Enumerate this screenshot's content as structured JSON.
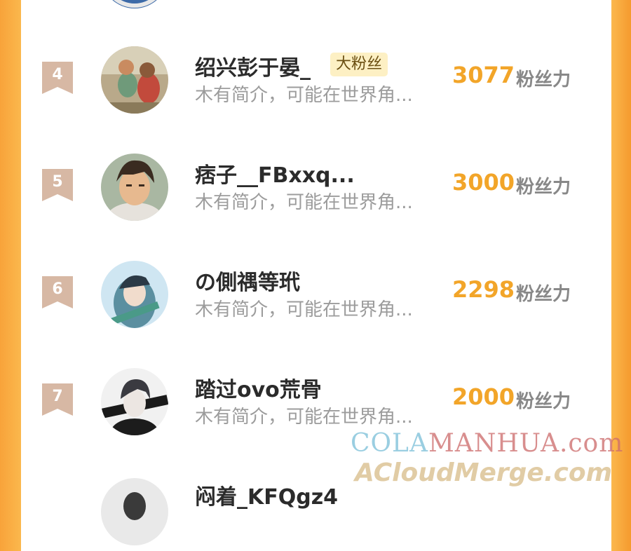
{
  "colors": {
    "accent": "#f2a529",
    "rank_badge": "#d7b8a4",
    "name": "#2b2b2b",
    "bio": "#9c9c9c",
    "badge_bg": "#fdf0c4"
  },
  "score_unit": "粉丝力",
  "rows": [
    {
      "rank": "4",
      "name": "绍兴彭于晏_",
      "badge": "大粉丝",
      "bio": "木有简介，可能在世界角...",
      "score": "3077",
      "avatar_icon": "avatar-icon"
    },
    {
      "rank": "5",
      "name": "痞子__FBxxq...",
      "badge": "",
      "bio": "木有简介，可能在世界角...",
      "score": "3000",
      "avatar_icon": "avatar-icon"
    },
    {
      "rank": "6",
      "name": "の側禑等玳",
      "badge": "",
      "bio": "木有简介，可能在世界角...",
      "score": "2298",
      "avatar_icon": "avatar-icon"
    },
    {
      "rank": "7",
      "name": "踏过ovo荒骨",
      "badge": "",
      "bio": "木有简介，可能在世界角...",
      "score": "2000",
      "avatar_icon": "avatar-icon"
    },
    {
      "rank": "",
      "name": "闷着_KFQgz4",
      "badge": "",
      "bio": "",
      "score": "",
      "avatar_icon": "avatar-icon"
    }
  ],
  "watermark": {
    "line1_part1": "COLA",
    "line1_part2": "MANHUA.com",
    "line2": "ACloudMerge.com"
  }
}
